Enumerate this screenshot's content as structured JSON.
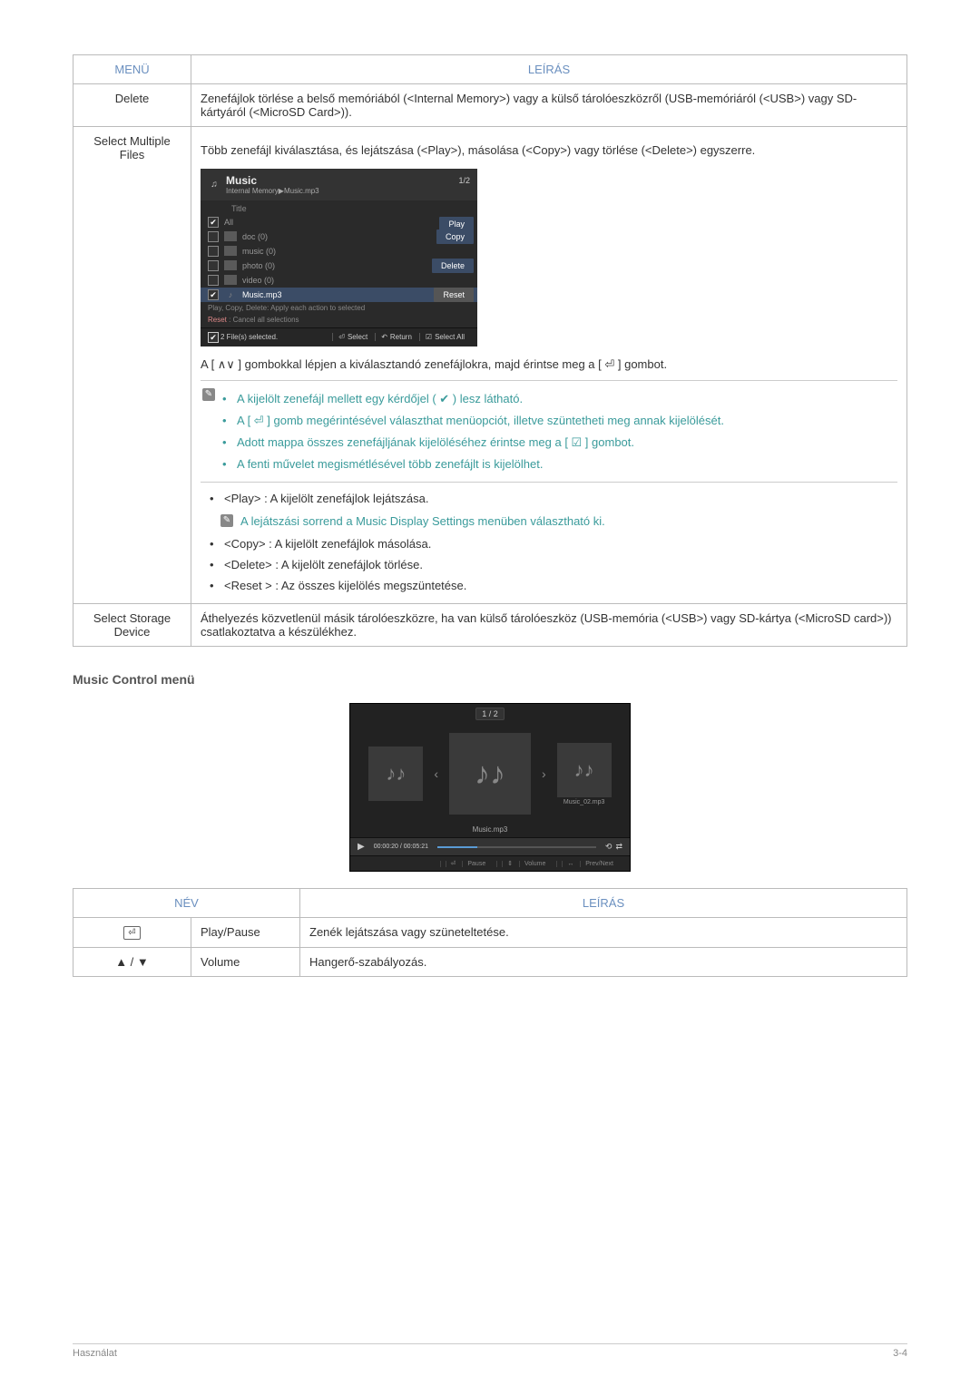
{
  "table1": {
    "headers": {
      "menu": "MENÜ",
      "desc": "LEÍRÁS"
    },
    "rows": {
      "delete": {
        "menu": "Delete",
        "desc": "Zenefájlok törlése a belső memóriából (<Internal Memory>) vagy a külső tárolóeszközről (USB-memóriáról (<USB>) vagy SD-kártyáról (<MicroSD Card>))."
      },
      "select_multiple": {
        "menu": "Select Multiple Files",
        "desc_top": "Több zenefájl kiválasztása, és lejátszása (<Play>), másolása (<Copy>) vagy törlése (<Delete>) egyszerre.",
        "ui": {
          "app_title": "Music",
          "breadcrumb": "Internal Memory▶Music.mp3",
          "page": "1/2",
          "title_label": "Title",
          "all": "All",
          "folders": {
            "doc": "doc (0)",
            "music": "music (0)",
            "photo": "photo (0)",
            "video": "video (0)"
          },
          "file": "Music.mp3",
          "actions": {
            "play": "Play",
            "copy": "Copy",
            "delete": "Delete",
            "reset": "Reset"
          },
          "help1": "Play, Copy, Delete: Apply each action to selected",
          "help_reset_label": "Reset",
          "help2": ": Cancel all selections",
          "footer": {
            "count": "2 File(s) selected.",
            "select": "Select",
            "return": "Return",
            "select_all": "Select All"
          }
        },
        "instruction": "A [ ∧∨ ] gombokkal lépjen a kiválasztandó zenefájlokra, majd érintse meg a [ ⏎ ] gombot.",
        "teal_items": {
          "a": "A kijelölt zenefájl mellett egy kérdőjel ( ✔ ) lesz látható.",
          "b": "A [ ⏎ ] gomb megérintésével választhat menüopciót, illetve szüntetheti meg annak kijelölését.",
          "c": "Adott mappa összes zenefájljának kijelöléséhez érintse meg a [ ☑ ] gombot.",
          "d": "A fenti művelet megismétlésével több zenefájlt is kijelölhet."
        },
        "bullets": {
          "play": "<Play> : A kijelölt zenefájlok lejátszása.",
          "play_note": "A lejátszási sorrend a Music Display Settings menüben választható ki.",
          "copy": "<Copy> : A kijelölt zenefájlok másolása.",
          "delete": "<Delete> : A kijelölt zenefájlok törlése.",
          "reset": "<Reset > : Az összes kijelölés megszüntetése."
        }
      },
      "select_storage": {
        "menu": "Select Storage Device",
        "desc": "Áthelyezés közvetlenül másik tárolóeszközre, ha van külső tárolóeszköz (USB-memória (<USB>) vagy SD-kártya (<MicroSD card>)) csatlakoztatva a készülékhez."
      }
    }
  },
  "section2_title": "Music Control menü",
  "player": {
    "page": "1 / 2",
    "thumb_caption": "Music_02.mp3",
    "now_playing": "Music.mp3",
    "time": "00:00:20 / 00:05:21",
    "foot": {
      "pause": "Pause",
      "volume": "Volume",
      "prevnext": "Prev/Next"
    }
  },
  "table2": {
    "headers": {
      "name": "NÉV",
      "desc": "LEÍRÁS"
    },
    "rows": {
      "play_pause": {
        "icon": "⏎",
        "name": "Play/Pause",
        "desc": "Zenék lejátszása vagy szüneteltetése."
      },
      "volume": {
        "icon": "▲ / ▼",
        "name": "Volume",
        "desc": "Hangerő-szabályozás."
      }
    }
  },
  "footer": {
    "left": "Használat",
    "right": "3-4"
  }
}
